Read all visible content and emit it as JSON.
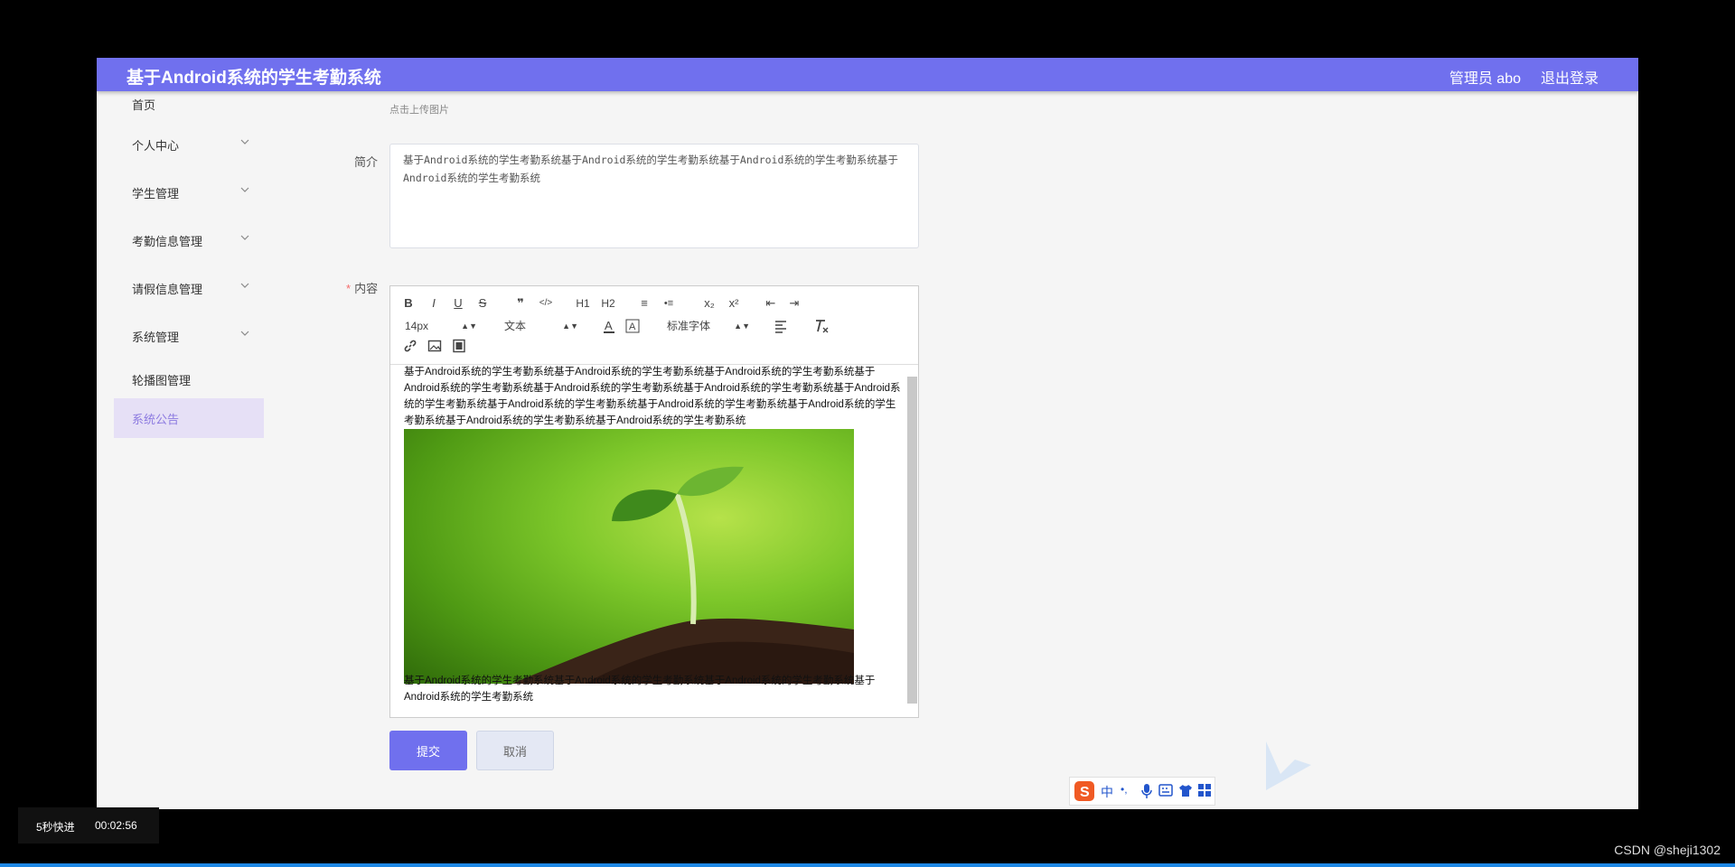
{
  "header": {
    "title": "基于Android系统的学生考勤系统",
    "admin_label": "管理员 abo",
    "logout": "退出登录"
  },
  "sidebar": {
    "items": [
      {
        "label": "首页",
        "expandable": false
      },
      {
        "label": "个人中心",
        "expandable": true
      },
      {
        "label": "学生管理",
        "expandable": true
      },
      {
        "label": "考勤信息管理",
        "expandable": true
      },
      {
        "label": "请假信息管理",
        "expandable": true
      },
      {
        "label": "系统管理",
        "expandable": true
      },
      {
        "label": "轮播图管理",
        "expandable": false
      },
      {
        "label": "系统公告",
        "expandable": false,
        "active": true
      }
    ]
  },
  "form": {
    "upload_hint": "点击上传图片",
    "intro_label": "简介",
    "intro_value": "基于Android系统的学生考勤系统基于Android系统的学生考勤系统基于Android系统的学生考勤系统基于Android系统的学生考勤系统",
    "content_label": "内容",
    "content_required_mark": "*",
    "editor": {
      "font_size": "14px",
      "block_format": "文本",
      "font_family": "标准字体",
      "toolbar_row1": [
        "B",
        "I",
        "U",
        "S",
        "❞",
        "</>",
        "H1",
        "H2",
        "≡",
        "•≡",
        "x₂",
        "x²",
        "⇤",
        "⇥"
      ],
      "text_before_image": "基于Android系统的学生考勤系统基于Android系统的学生考勤系统基于Android系统的学生考勤系统基于Android系统的学生考勤系统基于Android系统的学生考勤系统基于Android系统的学生考勤系统基于Android系统的学生考勤系统基于Android系统的学生考勤系统基于Android系统的学生考勤系统基于Android系统的学生考勤系统基于Android系统的学生考勤系统基于Android系统的学生考勤系统",
      "text_after_image": "基于Android系统的学生考勤系统基于Android系统的学生考勤系统基于Android系统的学生考勤系统基于Android系统的学生考勤系统"
    },
    "submit": "提交",
    "cancel": "取消"
  },
  "ime": {
    "mode": "中",
    "punct": "•,"
  },
  "video": {
    "skip_label": "5秒快进",
    "time": "00:02:56"
  },
  "credit": "CSDN @sheji1302",
  "colors": {
    "header": "#7070ee",
    "active_menu_bg": "#e6e0f6",
    "active_menu_text": "#8c7ae0",
    "required": "#f56c6c"
  }
}
